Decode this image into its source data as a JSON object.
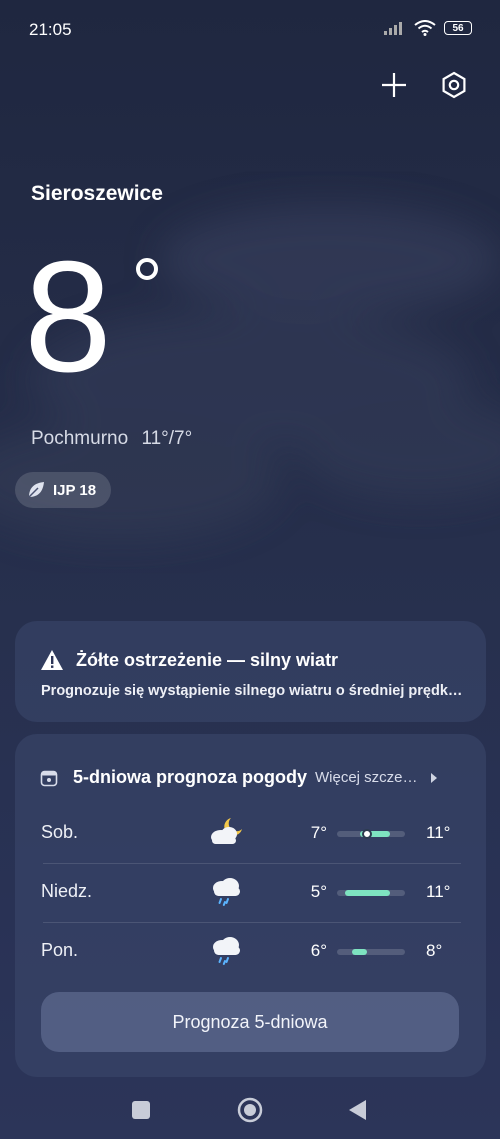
{
  "status_bar": {
    "time": "21:05",
    "battery": "56"
  },
  "location": {
    "city": "Sieroszewice"
  },
  "current": {
    "temperature": "8",
    "condition": "Pochmurno",
    "high_low": "11°/7°"
  },
  "aqi": {
    "label": "IJP 18"
  },
  "alert": {
    "title": "Żółte ostrzeżenie — silny wiatr",
    "text": "Prognozuje się wystąpienie silnego wiatru o średniej prędkości"
  },
  "forecast": {
    "title": "5-dniowa prognoza pogody",
    "more": "Więcej szczegółów",
    "days": [
      {
        "day": "Sob.",
        "icon": "partly-cloudy-night-icon",
        "low": "7°",
        "high": "11°",
        "low_value": 7,
        "high_value": 11,
        "current_value": 8
      },
      {
        "day": "Niedz.",
        "icon": "rain-cloud-icon",
        "low": "5°",
        "high": "11°",
        "low_value": 5,
        "high_value": 11
      },
      {
        "day": "Pon.",
        "icon": "rain-cloud-icon",
        "low": "6°",
        "high": "8°",
        "low_value": 6,
        "high_value": 8
      }
    ],
    "button": "Prognoza 5-dniowa",
    "range_min": 4,
    "range_max": 13
  },
  "colors": {
    "accent": "#7ee3c0",
    "background": "#242c47"
  }
}
